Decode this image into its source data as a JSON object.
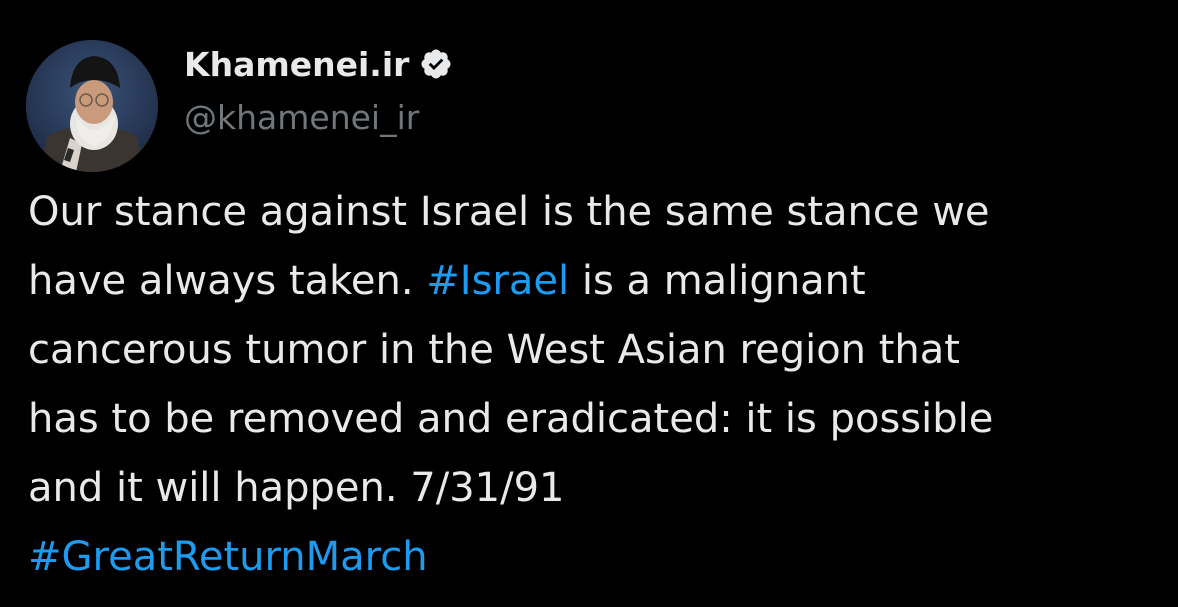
{
  "user": {
    "display_name": "Khamenei.ir",
    "handle": "@khamenei_ir",
    "verified": true
  },
  "tweet": {
    "line1": "Our stance against Israel is the same stance we",
    "line2_pre": "have always taken. ",
    "line2_tag": "#Israel",
    "line2_post": " is a malignant",
    "line3": "cancerous tumor in the West Asian region that",
    "line4": "has to be removed and eradicated: it is possible",
    "line5": "and it will happen. 7/31/91",
    "line6_tag": "#GreatReturnMarch"
  },
  "icons": {
    "verified": "verified-badge-icon",
    "avatar": "profile-photo"
  },
  "colors": {
    "background": "#000000",
    "text": "#e7e9ea",
    "secondary": "#71767b",
    "link": "#1d9bf0"
  }
}
